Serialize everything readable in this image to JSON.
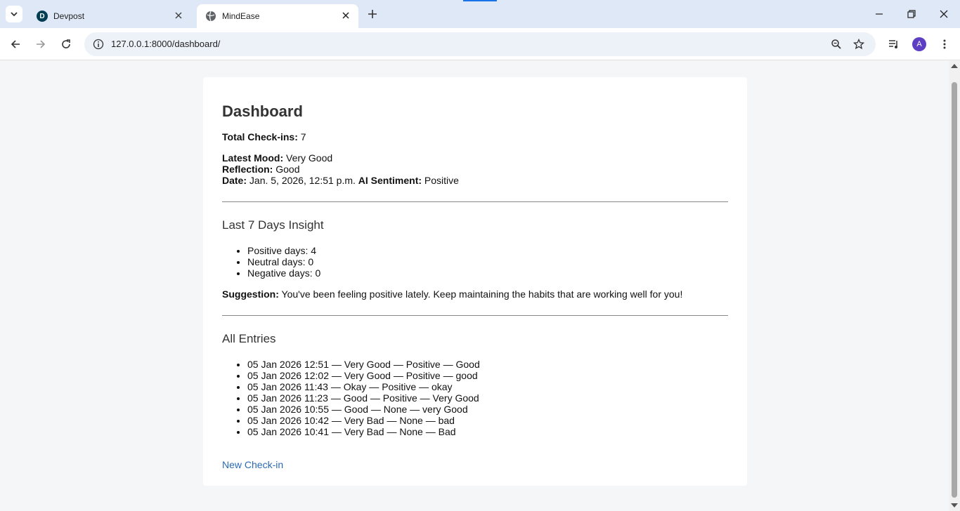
{
  "browser": {
    "tabs": [
      {
        "title": "Devpost",
        "favicon_letter": "D",
        "active": false
      },
      {
        "title": "MindEase",
        "active": true
      }
    ],
    "address_bar": {
      "url": "127.0.0.1:8000/dashboard/"
    },
    "profile_initial": "A"
  },
  "dashboard": {
    "title": "Dashboard",
    "total_checkins_label": "Total Check-ins:",
    "total_checkins_value": "7",
    "latest_mood_label": "Latest Mood:",
    "latest_mood_value": "Very Good",
    "reflection_label": "Reflection:",
    "reflection_value": "Good",
    "date_label": "Date:",
    "date_value": "Jan. 5, 2026, 12:51 p.m.",
    "ai_sentiment_label": "AI Sentiment:",
    "ai_sentiment_value": "Positive"
  },
  "insight": {
    "heading": "Last 7 Days Insight",
    "items": [
      "Positive days: 4",
      "Neutral days: 0",
      "Negative days: 0"
    ],
    "suggestion_label": "Suggestion:",
    "suggestion_text": "You've been feeling positive lately. Keep maintaining the habits that are working well for you!"
  },
  "entries": {
    "heading": "All Entries",
    "items": [
      "05 Jan 2026 12:51 — Very Good — Positive — Good",
      "05 Jan 2026 12:02 — Very Good — Positive — good",
      "05 Jan 2026 11:43 — Okay — Positive — okay",
      "05 Jan 2026 11:23 — Good — Positive — Very Good",
      "05 Jan 2026 10:55 — Good — None — very Good",
      "05 Jan 2026 10:42 — Very Bad — None — bad",
      "05 Jan 2026 10:41 — Very Bad — None — Bad"
    ]
  },
  "new_checkin_link": "New Check-in",
  "colors": {
    "link": "#2a6ab3",
    "tabstrip": "#dfe8f6",
    "avatar": "#5d3fc4"
  }
}
